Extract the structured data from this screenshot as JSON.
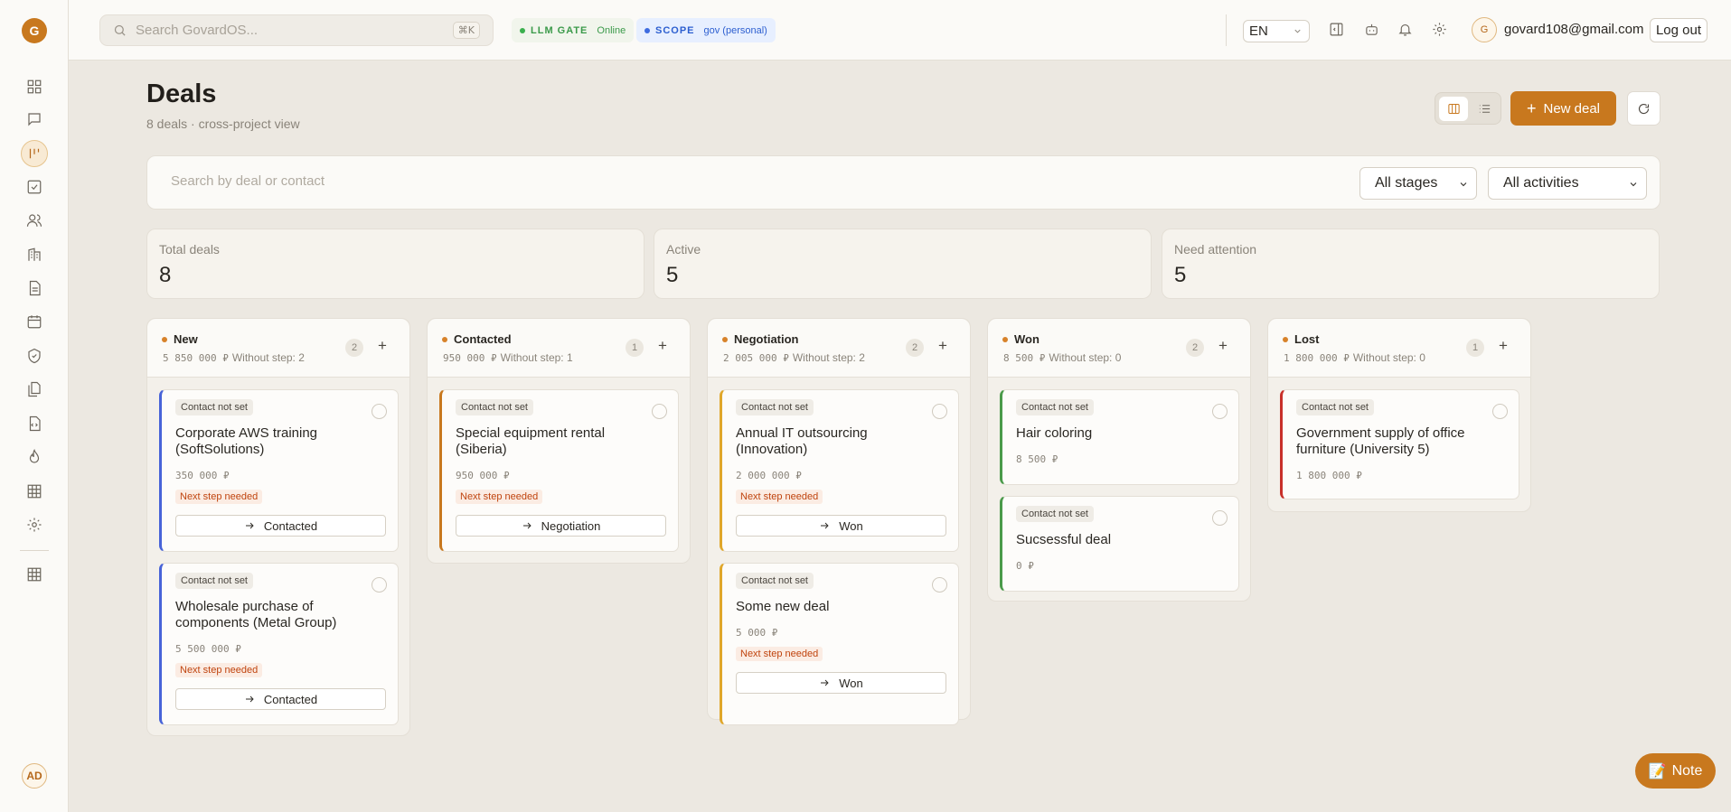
{
  "sidebar": {
    "logo_letter": "G",
    "user_initials": "AD",
    "items": [
      {
        "name": "dashboard-icon"
      },
      {
        "name": "chat-icon"
      },
      {
        "name": "deals-kanban-icon",
        "active": true
      },
      {
        "name": "tasks-icon"
      },
      {
        "name": "contacts-icon"
      },
      {
        "name": "companies-icon"
      },
      {
        "name": "documents-icon"
      },
      {
        "name": "calendar-icon"
      },
      {
        "name": "security-icon"
      },
      {
        "name": "files-icon"
      },
      {
        "name": "code-file-icon"
      },
      {
        "name": "fire-icon"
      },
      {
        "name": "table-icon"
      },
      {
        "name": "settings-icon"
      },
      {
        "name": "grid-icon"
      }
    ]
  },
  "topbar": {
    "search_placeholder": "Search GovardOS...",
    "search_shortcut": "⌘K",
    "gate_label": "LLM GATE",
    "gate_status": "Online",
    "scope_label": "SCOPE",
    "scope_value": "gov (personal)",
    "language": "EN",
    "user_initial": "G",
    "user_email": "govard108@gmail.com",
    "logout_label": "Log out"
  },
  "page": {
    "title": "Deals",
    "subtitle": "8 deals · cross-project view",
    "new_deal_label": "New deal",
    "search_placeholder": "Search by deal or contact",
    "stage_filter": "All stages",
    "activity_filter": "All activities"
  },
  "stats": [
    {
      "label": "Total deals",
      "value": "8"
    },
    {
      "label": "Active",
      "value": "5"
    },
    {
      "label": "Need attention",
      "value": "5"
    }
  ],
  "columns": [
    {
      "name": "New",
      "amount": "5 850 000 ₽",
      "without_step": "Without step: 2",
      "count": "2",
      "accent": "#4763d8",
      "cards": [
        {
          "contact": "Contact not set",
          "name": "Corporate AWS training (SoftSolutions)",
          "amount": "350 000 ₽",
          "warning": "Next step needed",
          "move": "Contacted"
        },
        {
          "contact": "Contact not set",
          "name": "Wholesale purchase of components (Metal Group)",
          "amount": "5 500 000 ₽",
          "warning": "Next step needed",
          "move": "Contacted"
        }
      ]
    },
    {
      "name": "Contacted",
      "amount": "950 000 ₽",
      "without_step": "Without step: 1",
      "count": "1",
      "accent": "#c8781e",
      "cards": [
        {
          "contact": "Contact not set",
          "name": "Special equipment rental (Siberia)",
          "amount": "950 000 ₽",
          "warning": "Next step needed",
          "move": "Negotiation"
        }
      ]
    },
    {
      "name": "Negotiation",
      "amount": "2 005 000 ₽",
      "without_step": "Without step: 2",
      "count": "2",
      "accent": "#e0a72a",
      "cards": [
        {
          "contact": "Contact not set",
          "name": "Annual IT outsourcing (Innovation)",
          "amount": "2 000 000 ₽",
          "warning": "Next step needed",
          "move": "Won"
        },
        {
          "contact": "Contact not set",
          "name": "Some new deal",
          "amount": "5 000 ₽",
          "warning": "Next step needed",
          "move": "Won"
        }
      ]
    },
    {
      "name": "Won",
      "amount": "8 500 ₽",
      "without_step": "Without step: 0",
      "count": "2",
      "accent": "#4a9a4a",
      "cards": [
        {
          "contact": "Contact not set",
          "name": "Hair coloring",
          "amount": "8 500 ₽"
        },
        {
          "contact": "Contact not set",
          "name": "Sucsessful deal",
          "amount": "0 ₽"
        }
      ]
    },
    {
      "name": "Lost",
      "amount": "1 800 000 ₽",
      "without_step": "Without step: 0",
      "count": "1",
      "accent": "#c8302a",
      "cards": [
        {
          "contact": "Contact not set",
          "name": "Government supply of office furniture (University 5)",
          "amount": "1 800 000 ₽"
        }
      ]
    }
  ],
  "note_label": "Note"
}
